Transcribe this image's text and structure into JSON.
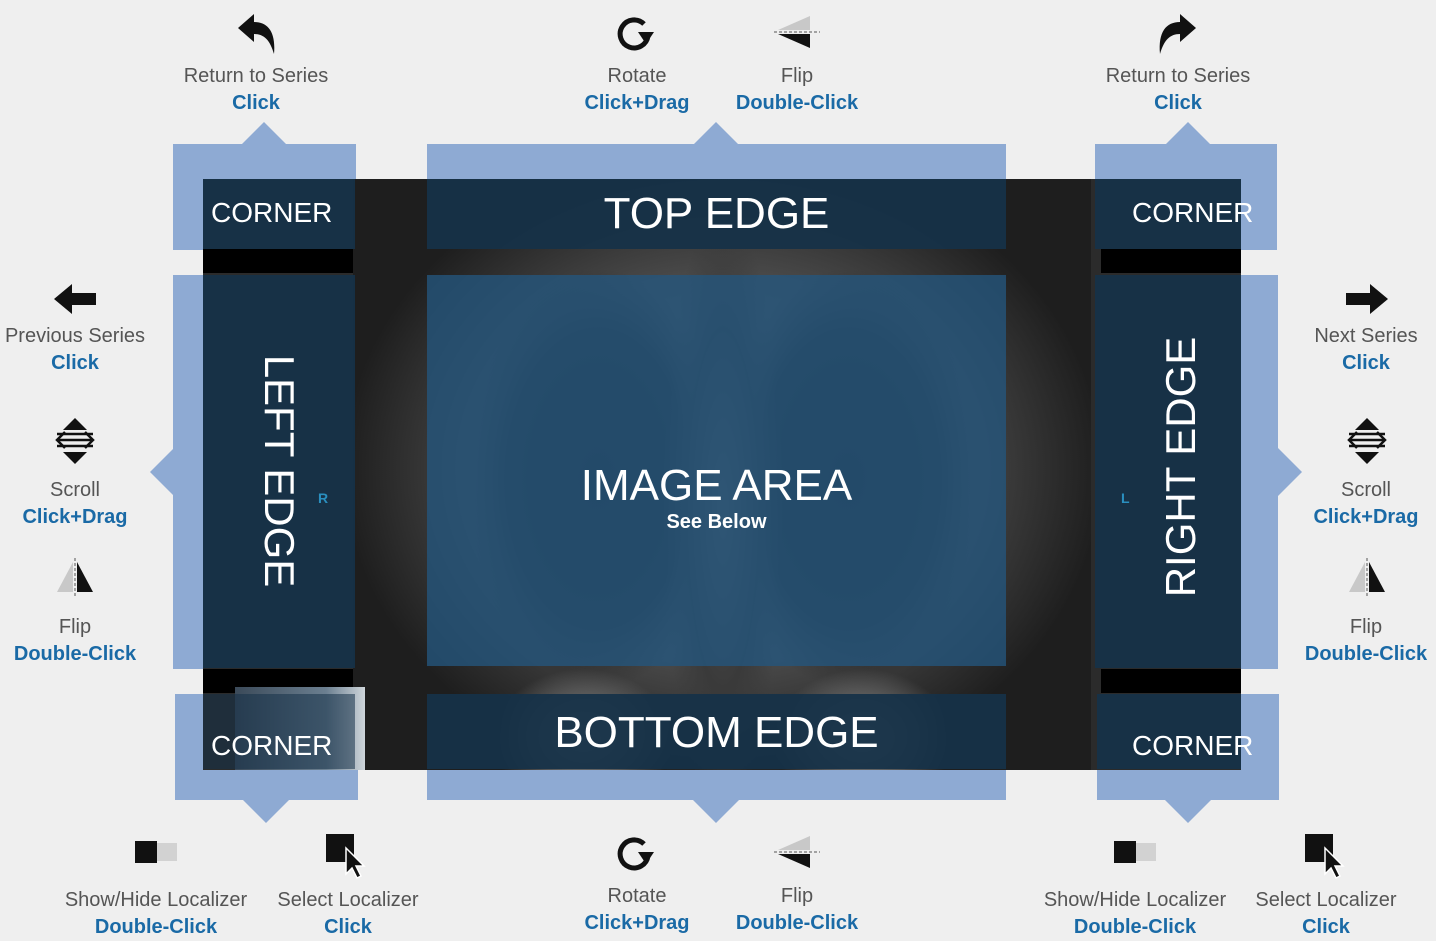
{
  "zones": {
    "corner": "CORNER",
    "top_edge": "TOP EDGE",
    "bottom_edge": "BOTTOM EDGE",
    "left_edge": "LEFT EDGE",
    "right_edge": "RIGHT EDGE",
    "image_area": "IMAGE AREA",
    "image_area_sub": "See Below"
  },
  "orientation": {
    "left": "R",
    "right": "L"
  },
  "top": {
    "left_corner": {
      "action": "Return to Series",
      "gesture": "Click",
      "icon": "return-left-icon"
    },
    "rotate": {
      "action": "Rotate",
      "gesture": "Click+Drag",
      "icon": "rotate-icon"
    },
    "flip": {
      "action": "Flip",
      "gesture": "Double-Click",
      "icon": "flip-vertical-icon"
    },
    "right_corner": {
      "action": "Return to Series",
      "gesture": "Click",
      "icon": "return-right-icon"
    }
  },
  "left": {
    "prev": {
      "action": "Previous Series",
      "gesture": "Click",
      "icon": "arrow-left-icon"
    },
    "scroll": {
      "action": "Scroll",
      "gesture": "Click+Drag",
      "icon": "scroll-icon"
    },
    "flip": {
      "action": "Flip",
      "gesture": "Double-Click",
      "icon": "flip-horizontal-icon"
    }
  },
  "right": {
    "next": {
      "action": "Next Series",
      "gesture": "Click",
      "icon": "arrow-right-icon"
    },
    "scroll": {
      "action": "Scroll",
      "gesture": "Click+Drag",
      "icon": "scroll-icon"
    },
    "flip": {
      "action": "Flip",
      "gesture": "Double-Click",
      "icon": "flip-horizontal-icon"
    }
  },
  "bottom": {
    "left_showhide": {
      "action": "Show/Hide Localizer",
      "gesture": "Double-Click",
      "icon": "localizer-toggle-icon"
    },
    "left_select": {
      "action": "Select Localizer",
      "gesture": "Click",
      "icon": "select-cursor-icon"
    },
    "rotate": {
      "action": "Rotate",
      "gesture": "Click+Drag",
      "icon": "rotate-icon"
    },
    "flip": {
      "action": "Flip",
      "gesture": "Double-Click",
      "icon": "flip-vertical-icon"
    },
    "right_showhide": {
      "action": "Show/Hide Localizer",
      "gesture": "Double-Click",
      "icon": "localizer-toggle-icon"
    },
    "right_select": {
      "action": "Select Localizer",
      "gesture": "Click",
      "icon": "select-cursor-icon"
    }
  },
  "colors": {
    "frame": "#8eaad3",
    "zone": "#163248",
    "gesture": "#1a6aa6",
    "action": "#555555"
  }
}
